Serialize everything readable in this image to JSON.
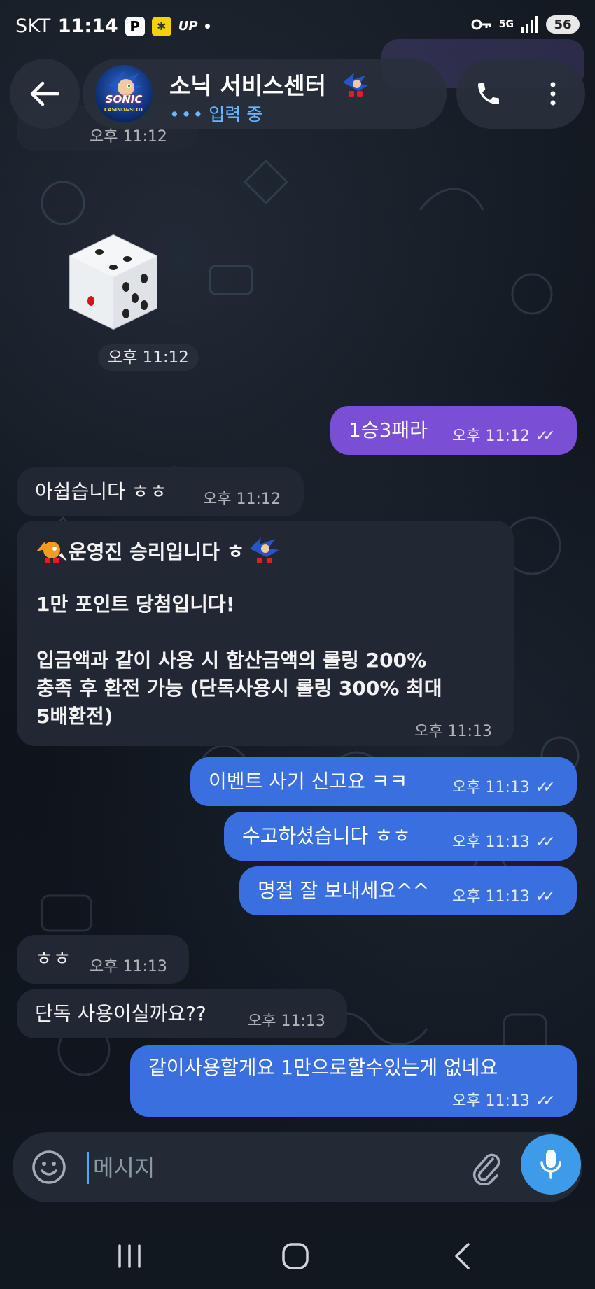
{
  "status_bar": {
    "carrier": "SKT",
    "time": "11:14",
    "badge_p": "P",
    "badge_up": "UP",
    "network": "5G",
    "battery": "56"
  },
  "header": {
    "avatar_logo": "SONIC",
    "avatar_sub": "CASINO&SLOT",
    "title": "소닉 서비스센터",
    "status_dots": "•••",
    "status": "입력 중"
  },
  "messages": [
    {
      "id": "m1",
      "dir": "in",
      "text": "",
      "time": "오후 11:12"
    },
    {
      "id": "dice",
      "dir": "in",
      "text": "",
      "time": "오후 11:12"
    },
    {
      "id": "m2",
      "dir": "out",
      "text": "1승3패라",
      "time": "오후 11:12"
    },
    {
      "id": "m3",
      "dir": "in",
      "text": "아쉽습니다 ㅎㅎ",
      "time": "오후 11:12"
    },
    {
      "id": "m4",
      "dir": "in",
      "lines": [
        "운영진  승리입니다 ㅎ",
        "",
        "1만 포인트 당첨입니다!",
        "",
        "입금액과 같이 사용 시 합산금액의 롤링 200%",
        "충족 후 환전 가능 (단독사용시 롤링 300% 최대",
        "5배환전)"
      ],
      "time": "오후 11:13"
    },
    {
      "id": "m5",
      "dir": "out",
      "text": "이벤트 사기 신고요 ㅋㅋ",
      "time": "오후 11:13"
    },
    {
      "id": "m6",
      "dir": "out",
      "text": "수고하셨습니다 ㅎㅎ",
      "time": "오후 11:13"
    },
    {
      "id": "m7",
      "dir": "out",
      "text": "명절 잘 보내세요^^",
      "time": "오후 11:13"
    },
    {
      "id": "m8",
      "dir": "in",
      "text": "ㅎㅎ",
      "time": "오후 11:13"
    },
    {
      "id": "m9",
      "dir": "in",
      "text": "단독 사용이실까요??",
      "time": "오후 11:13"
    },
    {
      "id": "m10",
      "dir": "out",
      "text": "같이사용할게요 1만으로할수있는게 없네요",
      "time": "오후 11:13"
    }
  ],
  "read_ticks": "✓✓",
  "input": {
    "placeholder": "메시지"
  },
  "colors": {
    "accent": "#3e9be9",
    "out_blue": "#3a6fe0",
    "out_purple": "#7a4fd6",
    "in_bubble": "#212833"
  }
}
